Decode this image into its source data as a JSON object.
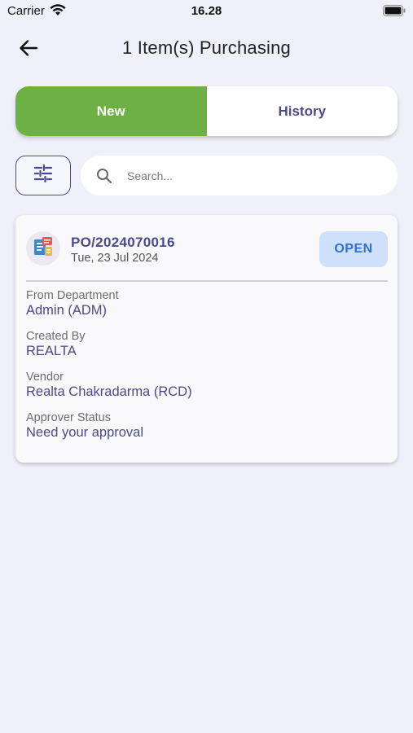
{
  "status_bar": {
    "carrier": "Carrier",
    "time": "16.28"
  },
  "header": {
    "title": "1 Item(s) Purchasing",
    "back_icon": "arrow-left-icon"
  },
  "tabs": [
    {
      "label": "New",
      "active": true
    },
    {
      "label": "History",
      "active": false
    }
  ],
  "filter": {
    "icon": "sliders-icon"
  },
  "search": {
    "placeholder": "Search...",
    "value": ""
  },
  "card": {
    "po_number": "PO/2024070016",
    "date": "Tue, 23 Jul 2024",
    "status_button": "OPEN",
    "fields": [
      {
        "label": "From Department",
        "value": "Admin (ADM)"
      },
      {
        "label": "Created By",
        "value": "REALTA"
      },
      {
        "label": "Vendor",
        "value": "Realta Chakradarma (RCD)"
      },
      {
        "label": "Approver Status",
        "value": "Need your approval"
      }
    ]
  },
  "colors": {
    "background": "#f0f0fb",
    "accent_green": "#6db145",
    "primary_text": "#4a4a8c",
    "open_button_bg": "#cfe0fb",
    "open_button_text": "#2f6fd6"
  }
}
